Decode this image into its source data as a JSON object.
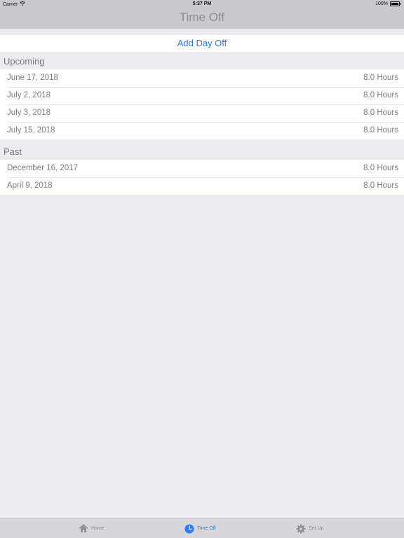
{
  "status_bar": {
    "carrier": "Carrier",
    "time": "5:37 PM",
    "battery": "100%"
  },
  "nav": {
    "title": "Time Off"
  },
  "add_button": {
    "label": "Add Day Off"
  },
  "sections": {
    "upcoming": {
      "title": "Upcoming",
      "rows": [
        {
          "date": "June 17, 2018",
          "hours": "8.0 Hours"
        },
        {
          "date": "July 2, 2018",
          "hours": "8.0 Hours"
        },
        {
          "date": "July 3, 2018",
          "hours": "8.0 Hours"
        },
        {
          "date": "July 15, 2018",
          "hours": "8.0 Hours"
        }
      ]
    },
    "past": {
      "title": "Past",
      "rows": [
        {
          "date": "December 16, 2017",
          "hours": "8.0 Hours"
        },
        {
          "date": "April 9, 2018",
          "hours": "8.0 Hours"
        }
      ]
    }
  },
  "tab_bar": {
    "tabs": [
      {
        "label": "Home",
        "icon": "house-icon",
        "active": false
      },
      {
        "label": "Time Off",
        "icon": "clock-icon",
        "active": true
      },
      {
        "label": "Set Up",
        "icon": "gear-icon",
        "active": false
      }
    ]
  },
  "colors": {
    "accent": "#1E7CF2",
    "bars": "#C9C9CE",
    "background": "#EBEBF0"
  }
}
